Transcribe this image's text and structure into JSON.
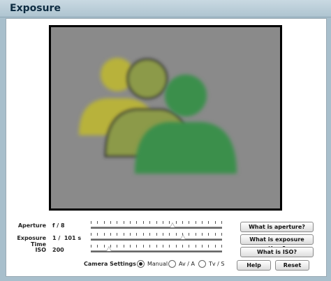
{
  "window": {
    "title": "Exposure"
  },
  "controls": {
    "aperture": {
      "label": "Aperture",
      "value": "f / 8",
      "level": 0.63
    },
    "exposure_time": {
      "label": "Exposure Time",
      "value": "1 /  101 s",
      "level": 0.71
    },
    "iso": {
      "label": "ISO",
      "value": "200",
      "level": 0.12
    }
  },
  "camera_settings": {
    "label": "Camera Settings",
    "options": [
      "Manual",
      "Av / A",
      "Tv / S"
    ],
    "selected": "Manual"
  },
  "buttons": {
    "what_aperture": "What is aperture?",
    "what_exposure": "What is exposure time?",
    "what_iso": "What is ISO?",
    "help": "Help",
    "reset": "Reset"
  },
  "preview": {
    "background": "#8a8a8a",
    "figure_colors": [
      "#b8b23a",
      "#8c9a4a",
      "#3a8f4c"
    ]
  }
}
